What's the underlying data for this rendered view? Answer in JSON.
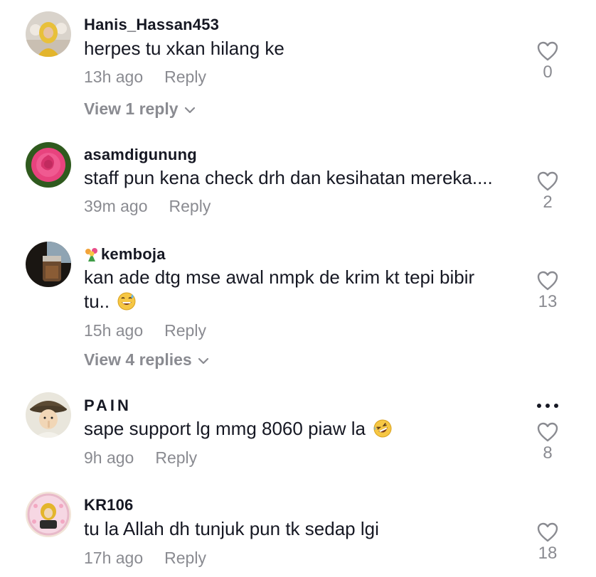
{
  "comments": [
    {
      "username": "Hanis_Hassan453",
      "text": "herpes tu xkan hilang ke",
      "time": "13h ago",
      "reply_label": "Reply",
      "likes": "0",
      "view_replies": "View 1 reply"
    },
    {
      "username": "asamdigunung",
      "text": "staff pun kena check drh dan kesihatan mereka....",
      "time": "39m ago",
      "reply_label": "Reply",
      "likes": "2"
    },
    {
      "username": "kemboja",
      "text_line1": "kan ade dtg mse awal nmpk de krim kt tepi bibir",
      "text_line2": "tu..",
      "time": "15h ago",
      "reply_label": "Reply",
      "likes": "13",
      "view_replies": "View 4 replies"
    },
    {
      "username": "PAIN",
      "text": "sape support lg mmg 8060 piaw la",
      "time": "9h ago",
      "reply_label": "Reply",
      "likes": "8"
    },
    {
      "username": "KR106",
      "text": "tu la Allah dh tunjuk pun tk sedap lgi",
      "time": "17h ago",
      "reply_label": "Reply",
      "likes": "18"
    }
  ],
  "icons": {
    "like": "heart-outline-icon",
    "expand": "chevron-down-icon",
    "more": "more-dots-icon",
    "sweat_smile": "grinning-sweat-emoji",
    "rofl": "rolling-laughing-emoji",
    "bouquet": "bouquet-emoji"
  },
  "colors": {
    "text_primary": "#161823",
    "text_secondary": "#8a8b91",
    "background": "#ffffff"
  }
}
